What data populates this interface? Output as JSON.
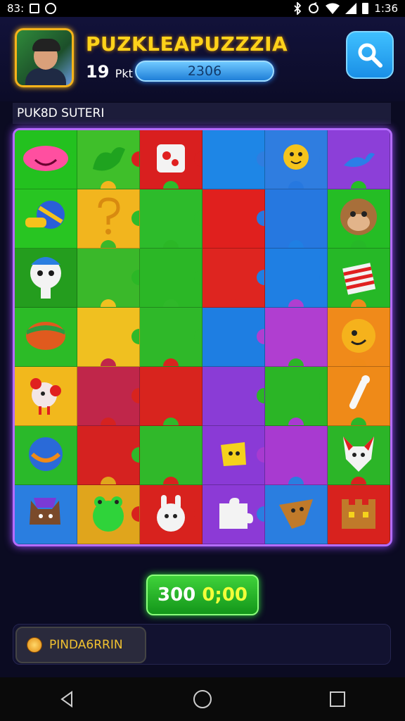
{
  "status_bar": {
    "left_text": "83:",
    "time": "1:36",
    "icons": [
      "image-icon",
      "camera-icon",
      "bluetooth-icon",
      "sync-icon",
      "wifi-icon",
      "signal-icon",
      "battery-icon"
    ]
  },
  "header": {
    "title": "PUZKLEAPUZZZIA",
    "level_number": "19",
    "level_unit": "Pkt",
    "score": "2306",
    "search_icon": "search-icon"
  },
  "puzzle_label": "PUK8D SUTERI",
  "board": {
    "rows": 7,
    "cols": 6,
    "cells": [
      {
        "color": "#23c11f",
        "icon": "pink-blob-icon"
      },
      {
        "color": "#3fbf2a",
        "icon": "green-piece-icon"
      },
      {
        "color": "#d91f1f",
        "icon": "red-piece-icon"
      },
      {
        "color": "#1e86e6",
        "icon": ""
      },
      {
        "color": "#2f7de0",
        "icon": "yellow-creature-icon"
      },
      {
        "color": "#8c3fd8",
        "icon": "blue-bird-icon"
      },
      {
        "color": "#28c522",
        "icon": "striped-ball-icon"
      },
      {
        "color": "#f2b51e",
        "icon": "question-mark-icon"
      },
      {
        "color": "#2dbb2b",
        "icon": ""
      },
      {
        "color": "#e0201e",
        "icon": ""
      },
      {
        "color": "#2678e0",
        "icon": ""
      },
      {
        "color": "#25bd25",
        "icon": "brown-monkey-icon"
      },
      {
        "color": "#249d1e",
        "icon": "white-bird-icon"
      },
      {
        "color": "#3ab82a",
        "icon": ""
      },
      {
        "color": "#2bb726",
        "icon": ""
      },
      {
        "color": "#de2520",
        "icon": ""
      },
      {
        "color": "#1f7fe3",
        "icon": ""
      },
      {
        "color": "#26b827",
        "icon": "gift-box-icon"
      },
      {
        "color": "#2cbb27",
        "icon": "planet-icon"
      },
      {
        "color": "#f0c020",
        "icon": ""
      },
      {
        "color": "#2fb829",
        "icon": ""
      },
      {
        "color": "#1e7ee2",
        "icon": ""
      },
      {
        "color": "#b03ed0",
        "icon": ""
      },
      {
        "color": "#f08a1a",
        "icon": "orange-face-icon"
      },
      {
        "color": "#f2b81c",
        "icon": "red-bird-icon"
      },
      {
        "color": "#c0264a",
        "icon": ""
      },
      {
        "color": "#d8241e",
        "icon": ""
      },
      {
        "color": "#8a3cd6",
        "icon": ""
      },
      {
        "color": "#2bb526",
        "icon": ""
      },
      {
        "color": "#ef8a18",
        "icon": "bone-icon"
      },
      {
        "color": "#2ab92a",
        "icon": "blue-swirl-icon"
      },
      {
        "color": "#d52220",
        "icon": ""
      },
      {
        "color": "#30b82a",
        "icon": ""
      },
      {
        "color": "#8a3ad6",
        "icon": "yellow-star-piece-icon"
      },
      {
        "color": "#a83ad0",
        "icon": ""
      },
      {
        "color": "#2cb528",
        "icon": "fox-icon"
      },
      {
        "color": "#2a7ee0",
        "icon": "purple-cat-icon"
      },
      {
        "color": "#e0a51c",
        "icon": "green-frog-icon"
      },
      {
        "color": "#d8221e",
        "icon": "white-bunny-icon"
      },
      {
        "color": "#8c3ad6",
        "icon": "white-piece-icon"
      },
      {
        "color": "#2a7ee0",
        "icon": "brown-bird-icon"
      },
      {
        "color": "#d8221e",
        "icon": "castle-icon"
      }
    ]
  },
  "timer": {
    "value_a": "300",
    "value_b": "0;00"
  },
  "find_button": {
    "label": "PINDA6RRIN",
    "icon": "coin-icon"
  },
  "navigation": [
    "back-icon",
    "home-icon",
    "recents-icon"
  ]
}
